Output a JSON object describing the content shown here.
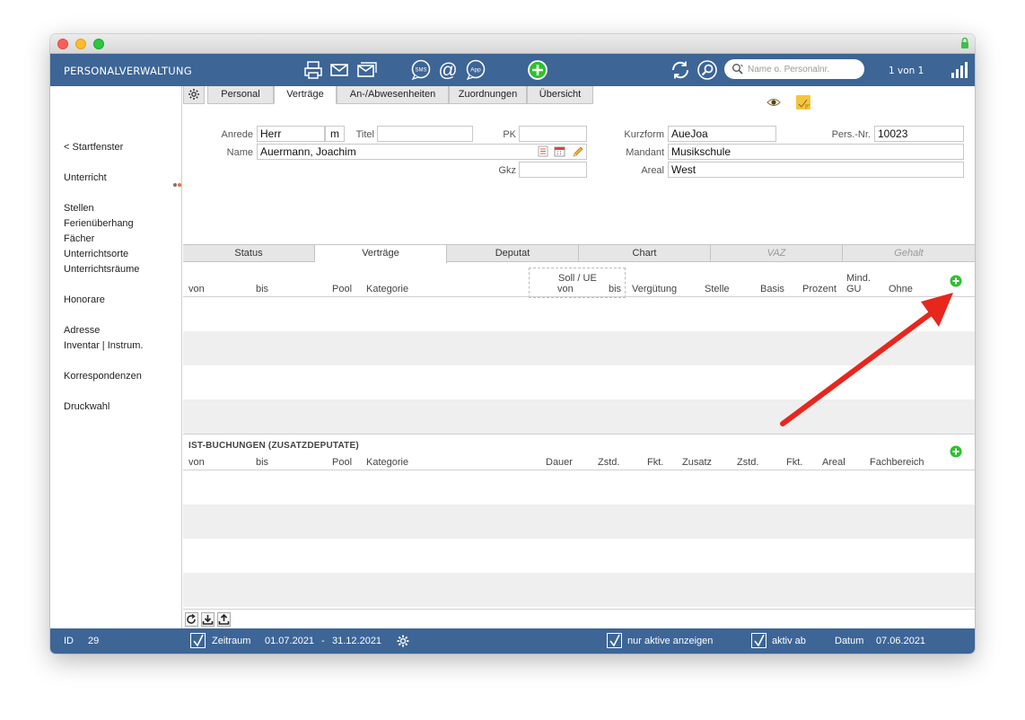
{
  "app": {
    "title": "PERSONALVERWALTUNG",
    "record_counter": "1 von 1",
    "search_placeholder": "Name o. Personalnr."
  },
  "toolbar": {
    "icons": [
      "printer-icon",
      "mail-icon",
      "mail-multi-icon",
      "sms-icon",
      "at-icon",
      "app-icon",
      "add-icon",
      "refresh-icon",
      "search-icon",
      "signal-icon"
    ],
    "sms_label": "SMS",
    "at_label": "@",
    "app_label": "App"
  },
  "sidebar": {
    "back": "< Startfenster",
    "items": [
      "Unterricht",
      "Stellen",
      "Ferienüberhang",
      "Fächer",
      "Unterrichtsorte",
      "Unterrichtsräume",
      "Honorare",
      "Adresse",
      "Inventar | Instrum.",
      "Korrespondenzen",
      "Druckwahl"
    ]
  },
  "tabs": [
    "Personal",
    "Verträge",
    "An-/Abwesenheiten",
    "Zuordnungen",
    "Übersicht"
  ],
  "active_tab": "Verträge",
  "form": {
    "anrede_label": "Anrede",
    "anrede_value": "Herr",
    "anrede_suffix": "m",
    "titel_label": "Titel",
    "titel_value": "",
    "pk_label": "PK",
    "pk_value": "",
    "name_label": "Name",
    "name_value": "Auermann, Joachim",
    "gkz_label": "Gkz",
    "gkz_value": "",
    "kurzform_label": "Kurzform",
    "kurzform_value": "AueJoa",
    "persnr_label": "Pers.-Nr.",
    "persnr_value": "10023",
    "mandant_label": "Mandant",
    "mandant_value": "Musikschule",
    "areal_label": "Areal",
    "areal_value": "West"
  },
  "subtabs": [
    "Status",
    "Verträge",
    "Deputat",
    "Chart",
    "VAZ",
    "Gehalt"
  ],
  "active_subtab": "Verträge",
  "contracts_table": {
    "headers": {
      "von": "von",
      "bis": "bis",
      "pool": "Pool",
      "kategorie": "Kategorie",
      "soll_ue": "Soll / UE",
      "soll_von": "von",
      "soll_bis": "bis",
      "verguetung": "Vergütung",
      "stelle": "Stelle",
      "basis": "Basis",
      "prozent": "Prozent",
      "mind": "Mind.",
      "gu": "GU",
      "ohne": "Ohne"
    },
    "rows": []
  },
  "bookings": {
    "title": "IST-BUCHUNGEN (ZUSATZDEPUTATE)",
    "headers": {
      "von": "von",
      "bis": "bis",
      "pool": "Pool",
      "kategorie": "Kategorie",
      "dauer": "Dauer",
      "zstd1": "Zstd.",
      "fkt1": "Fkt.",
      "zusatz": "Zusatz",
      "zstd2": "Zstd.",
      "fkt2": "Fkt.",
      "areal": "Areal",
      "fachbereich": "Fachbereich"
    },
    "rows": []
  },
  "status": {
    "id_label": "ID",
    "id_value": "29",
    "zeitraum_label": "Zeitraum",
    "zeitraum_from": "01.07.2021",
    "zeitraum_sep": "-",
    "zeitraum_to": "31.12.2021",
    "nur_aktive_label": "nur aktive anzeigen",
    "aktiv_ab_label": "aktiv ab",
    "datum_label": "Datum",
    "datum_value": "07.06.2021"
  },
  "colors": {
    "bar": "#3d6596",
    "accent_green": "#2ec02e",
    "arrow_red": "#e8261c",
    "row_alt": "#efefef"
  }
}
